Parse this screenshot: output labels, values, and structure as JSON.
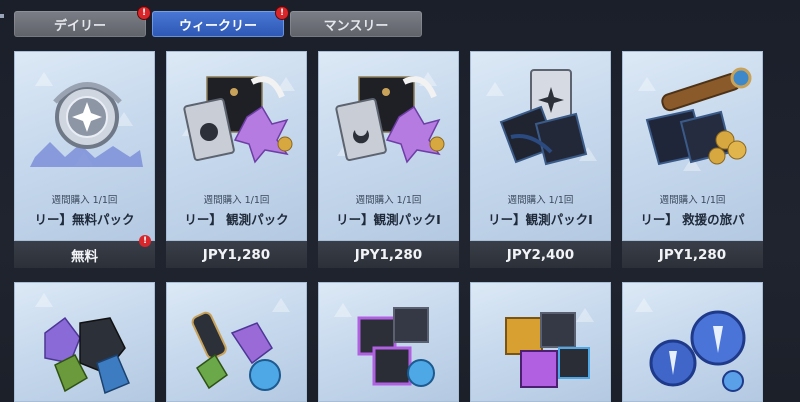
{
  "tabs": [
    {
      "label": "デイリー",
      "alert": "!"
    },
    {
      "label": "ウィークリー",
      "alert": "!"
    },
    {
      "label": "マンスリー"
    }
  ],
  "colors": {
    "active_tab": "#3a66c4",
    "alert": "#d8262a",
    "card_bg": "#c7d9ed",
    "price_bar": "#2f333c"
  },
  "cards": [
    {
      "limit": "週間購入 1/1回",
      "name": "リー】無料パック",
      "price": "無料",
      "alert": "!",
      "icon": "silver-compass-emblem-icon"
    },
    {
      "limit": "週間購入 1/1回",
      "name": "リー】 観測パック",
      "price": "JPY1,280",
      "icon": "envelope-tickets-crystals-icon"
    },
    {
      "limit": "週間購入 1/1回",
      "name": "リー】観測パックI",
      "price": "JPY1,280",
      "icon": "envelope-tickets-crystals-icon"
    },
    {
      "limit": "週間購入 1/1回",
      "name": "リー】観測パックI",
      "price": "JPY2,400",
      "icon": "ticket-letters-icon"
    },
    {
      "limit": "週間購入 1/1回",
      "name": "リー】 救援の旅パ",
      "price": "JPY1,280",
      "icon": "telescope-coins-icon"
    }
  ],
  "cards_row2": [
    {
      "icon": "green-crystal-ore-icon"
    },
    {
      "icon": "green-vial-orb-icon"
    },
    {
      "icon": "purple-cube-crates-icon"
    },
    {
      "icon": "gold-cube-crates-icon"
    },
    {
      "icon": "blue-crystal-tokens-icon"
    }
  ]
}
